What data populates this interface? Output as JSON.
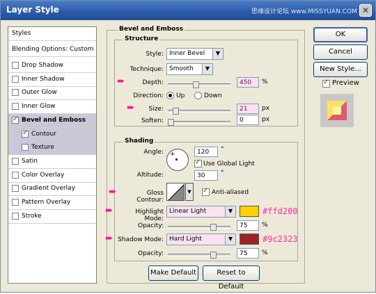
{
  "window": {
    "title": "Layer Style",
    "watermark": "思缘设计论坛  www.MISSYUAN.COM",
    "close_glyph": "✕"
  },
  "styles_list": {
    "header": "Styles",
    "blending": "Blending Options: Custom",
    "items": [
      {
        "label": "Drop Shadow",
        "checked": false
      },
      {
        "label": "Inner Shadow",
        "checked": false
      },
      {
        "label": "Outer Glow",
        "checked": false
      },
      {
        "label": "Inner Glow",
        "checked": false
      },
      {
        "label": "Bevel and Emboss",
        "checked": true
      },
      {
        "label": "Contour",
        "checked": true
      },
      {
        "label": "Texture",
        "checked": false
      },
      {
        "label": "Satin",
        "checked": false
      },
      {
        "label": "Color Overlay",
        "checked": false
      },
      {
        "label": "Gradient Overlay",
        "checked": false
      },
      {
        "label": "Pattern Overlay",
        "checked": false
      },
      {
        "label": "Stroke",
        "checked": false
      }
    ]
  },
  "bevel": {
    "title": "Bevel and Emboss",
    "structure": {
      "title": "Structure",
      "style_label": "Style:",
      "style_value": "Inner Bevel",
      "technique_label": "Technique:",
      "technique_value": "Smooth",
      "depth_label": "Depth:",
      "depth_value": "450",
      "depth_unit": "%",
      "depth_fraction": 0.45,
      "direction_label": "Direction:",
      "dir_up": "Up",
      "dir_down": "Down",
      "size_label": "Size:",
      "size_value": "21",
      "size_unit": "px",
      "size_fraction": 0.085,
      "soften_label": "Soften:",
      "soften_value": "0",
      "soften_unit": "px",
      "soften_fraction": 0.0
    },
    "shading": {
      "title": "Shading",
      "angle_label": "Angle:",
      "angle_value": "120",
      "angle_unit": "°",
      "global_light_label": "Use Global Light",
      "altitude_label": "Altitude:",
      "altitude_value": "30",
      "altitude_unit": "°",
      "gloss_label": "Gloss Contour:",
      "anti_aliased_label": "Anti-aliased",
      "highlight_label": "Highlight Mode:",
      "highlight_mode": "Linear Light",
      "highlight_color": "#ffd200",
      "highlight_hex": "#ffd200",
      "opacity1_label": "Opacity:",
      "opacity1_value": "75",
      "opacity1_unit": "%",
      "shadow_label": "Shadow Mode:",
      "shadow_mode": "Hard Light",
      "shadow_color": "#9c2323",
      "shadow_hex": "#9c2323",
      "opacity2_label": "Opacity:",
      "opacity2_value": "75",
      "opacity2_unit": "%"
    },
    "make_default": "Make Default",
    "reset_default": "Reset to Default"
  },
  "buttons": {
    "ok": "OK",
    "cancel": "Cancel",
    "new_style": "New Style...",
    "preview": "Preview"
  }
}
